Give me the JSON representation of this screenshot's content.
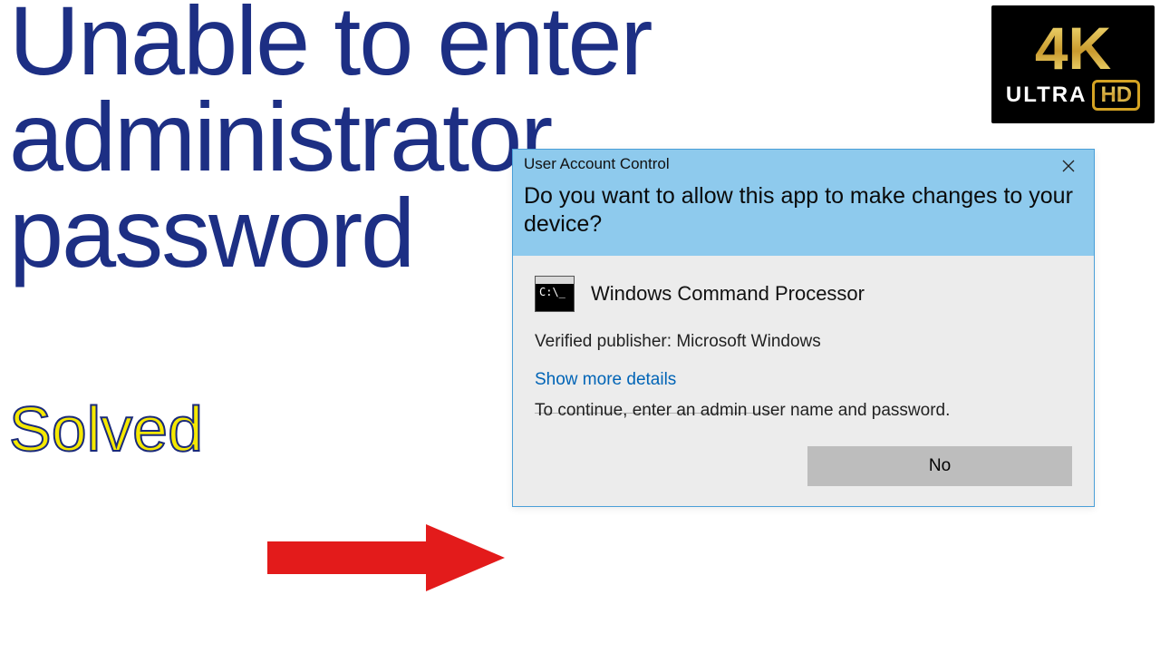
{
  "headline": {
    "line1": "Unable to enter",
    "line2": "administrator",
    "line3": "password",
    "solved": "Solved"
  },
  "badge4k": {
    "top": "4K",
    "ultra": "ULTRA",
    "hd": "HD"
  },
  "uac": {
    "title": "User Account Control",
    "question": "Do you want to allow this app to make changes to your device?",
    "app_name": "Windows Command Processor",
    "publisher": "Verified publisher: Microsoft Windows",
    "show_more": "Show more details",
    "continue_text": "To continue, enter an admin user name and password.",
    "no_label": "No",
    "cmd_icon_text": "C:\\_"
  }
}
